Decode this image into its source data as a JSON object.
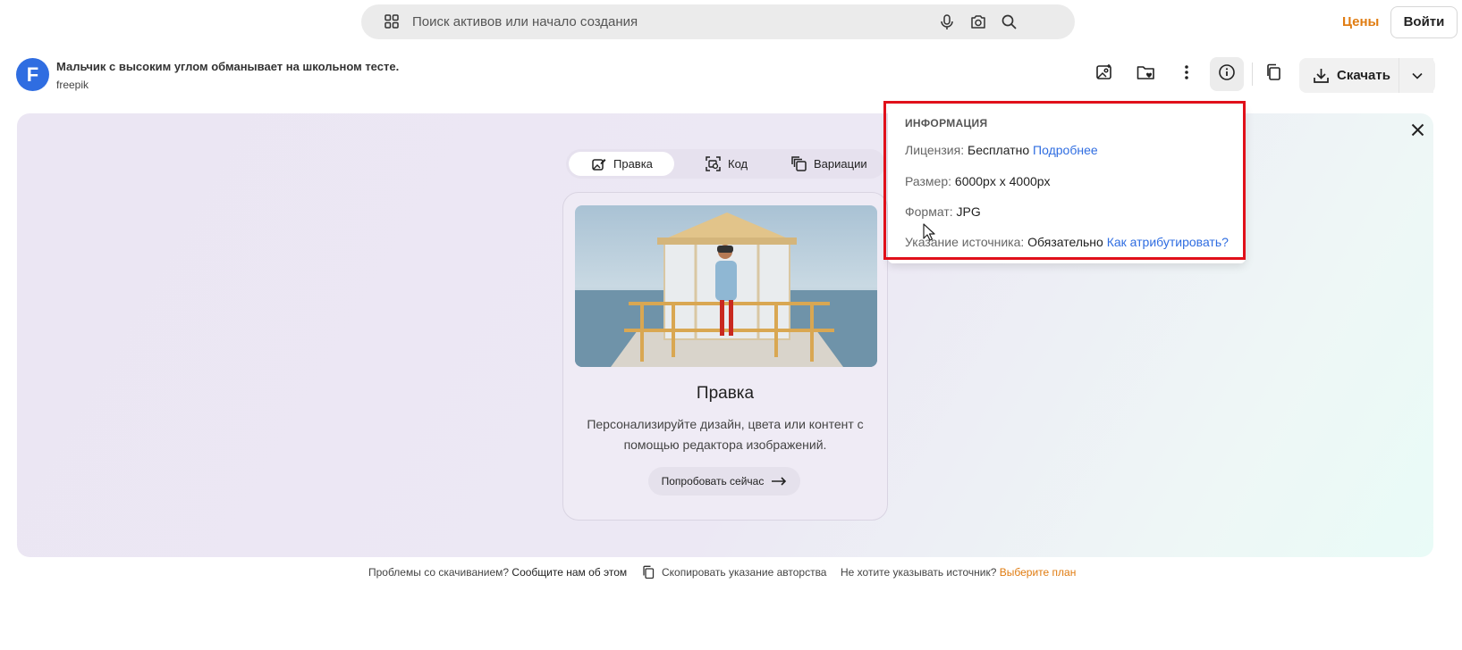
{
  "search": {
    "placeholder": "Поиск активов или начало создания"
  },
  "nav": {
    "pricing_label": "Цены",
    "login_label": "Войти"
  },
  "asset": {
    "avatar_letter": "F",
    "title": "Мальчик с высоким углом обманывает на школьном тесте.",
    "author": "freepik"
  },
  "toolbar": {
    "download_label": "Скачать"
  },
  "tabs": [
    {
      "label": "Правка",
      "icon": "edit-image-icon",
      "active": true
    },
    {
      "label": "Код",
      "icon": "code-image-icon",
      "active": false
    },
    {
      "label": "Вариации",
      "icon": "variations-icon",
      "active": false
    }
  ],
  "card": {
    "title": "Правка",
    "description": "Персонализируйте дизайн, цвета или контент с помощью редактора изображений.",
    "button_label": "Попробовать сейчас"
  },
  "info": {
    "heading": "ИНФОРМАЦИЯ",
    "license_key": "Лицензия:",
    "license_value": "Бесплатно",
    "license_link": "Подробнее",
    "size_key": "Размер:",
    "size_value": "6000px x 4000px",
    "format_key": "Формат:",
    "format_value": "JPG",
    "attribution_key": "Указание источника:",
    "attribution_value": "Обязательно",
    "attribution_link": "Как атрибутировать?"
  },
  "footer": {
    "problems_text": "Проблемы со скачиванием?",
    "report_link": "Сообщите нам об этом",
    "copy_attribution": "Скопировать указание авторства",
    "no_attribution_text": "Не хотите указывать источник?",
    "plan_link": "Выберите план"
  },
  "colors": {
    "accent_orange": "#e07c11",
    "link_blue": "#2f6de1",
    "highlight_red": "#e0101a"
  }
}
